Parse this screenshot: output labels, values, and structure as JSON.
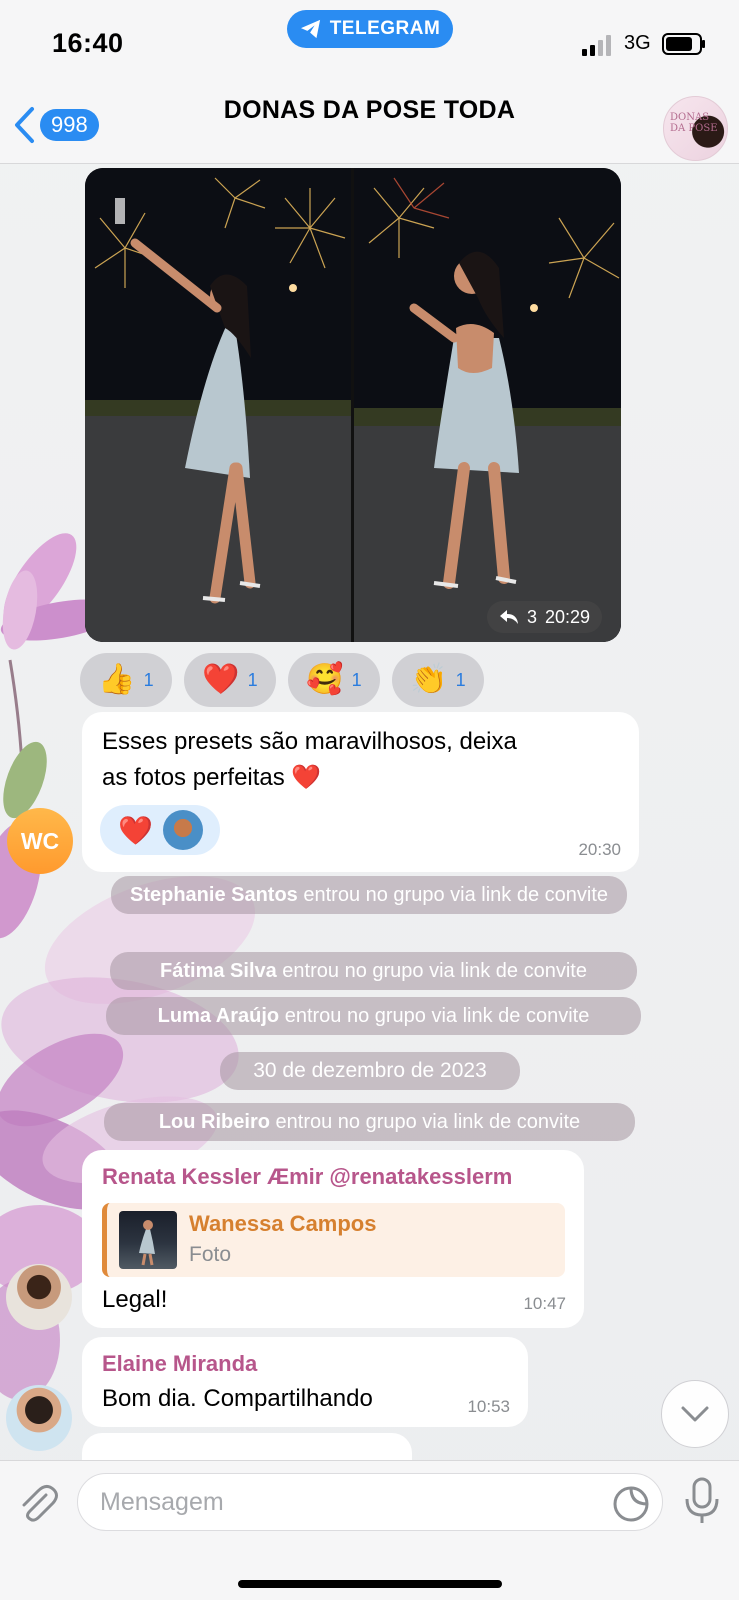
{
  "status_bar": {
    "time": "16:40",
    "app_pill": "TELEGRAM",
    "network": "3G"
  },
  "header": {
    "back_count": "998",
    "title": "DONAS DA POSE TODA",
    "avatar_text": "DONAS DA POSE"
  },
  "album": {
    "forwards": "3",
    "time": "20:29",
    "reactions": [
      {
        "emoji": "👍",
        "count": "1"
      },
      {
        "emoji": "❤️",
        "count": "1"
      },
      {
        "emoji": "🥰",
        "count": "1"
      },
      {
        "emoji": "👏",
        "count": "1"
      }
    ]
  },
  "messages": {
    "wc": {
      "avatar_initials": "WC",
      "line1": "Esses presets são maravilhosos, deixa",
      "line2": "as fotos perfeitas ❤️",
      "reaction": "❤️",
      "time": "20:30"
    },
    "renata": {
      "sender": "Renata Kessler Æmir @renatakesslerm",
      "reply_name": "Wanessa Campos",
      "reply_type": "Foto",
      "text": "Legal!",
      "time": "10:47"
    },
    "elaine": {
      "sender": "Elaine Miranda",
      "text": "Bom dia. Compartilhando",
      "time": "10:53"
    }
  },
  "service": {
    "stephanie_name": "Stephanie Santos",
    "stephanie_text": " entrou no grupo via link de convite",
    "fatima_name": "Fátima Silva",
    "fatima_text": " entrou no grupo via link de convite",
    "luma_name": "Luma Araújo",
    "luma_text": " entrou no grupo via link de convite",
    "date": "30 de dezembro de 2023",
    "lou_name": "Lou Ribeiro",
    "lou_text": " entrou no grupo via link de convite"
  },
  "input": {
    "placeholder": "Mensagem"
  },
  "colors": {
    "accent": "#2a8cf2",
    "sender": "#b7568b",
    "reply": "#d6802f"
  }
}
